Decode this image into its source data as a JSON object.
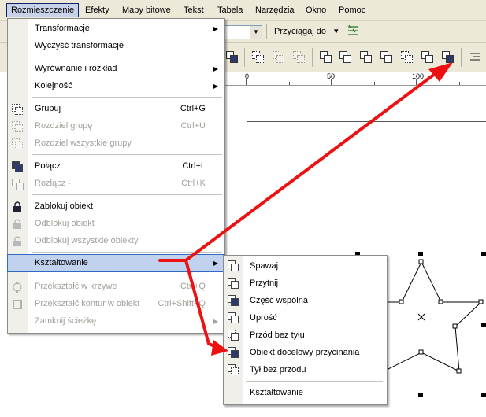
{
  "menubar": {
    "items": [
      {
        "label": "Rozmieszczenie",
        "name": "menu-rozmieszczenie",
        "active": true
      },
      {
        "label": "Efekty",
        "name": "menu-efekty"
      },
      {
        "label": "Mapy bitowe",
        "name": "menu-mapy-bitowe"
      },
      {
        "label": "Tekst",
        "name": "menu-tekst"
      },
      {
        "label": "Tabela",
        "name": "menu-tabela"
      },
      {
        "label": "Narzędzia",
        "name": "menu-narzedzia"
      },
      {
        "label": "Okno",
        "name": "menu-okno"
      },
      {
        "label": "Pomoc",
        "name": "menu-pomoc"
      }
    ]
  },
  "toolbar": {
    "snap_label": "Przyciągaj do",
    "snap_arrow": "▾"
  },
  "ruler": {
    "ticks": [
      "0",
      "50",
      "100"
    ]
  },
  "dropdown": {
    "items": [
      {
        "label": "Transformacje",
        "submenu": true
      },
      {
        "label": "Wyczyść transformacje"
      },
      {
        "label": "Wyrównanie i rozkład",
        "submenu": true
      },
      {
        "label": "Kolejność",
        "submenu": true
      },
      {
        "label": "Grupuj",
        "shortcut": "Ctrl+G",
        "icon": "group-icon"
      },
      {
        "label": "Rozdziel grupę",
        "shortcut": "Ctrl+U",
        "disabled": true,
        "icon": "ungroup-icon"
      },
      {
        "label": "Rozdziel wszystkie grupy",
        "disabled": true,
        "icon": "ungroup-all-icon"
      },
      {
        "label": "Połącz",
        "shortcut": "Ctrl+L",
        "icon": "combine-icon"
      },
      {
        "label": "Rozłącz -",
        "shortcut": "Ctrl+K",
        "disabled": true,
        "icon": "break-apart-icon"
      },
      {
        "label": "Zablokuj obiekt",
        "icon": "lock-icon"
      },
      {
        "label": "Odblokuj obiekt",
        "disabled": true,
        "icon": "unlock-icon"
      },
      {
        "label": "Odblokuj wszystkie obiekty",
        "disabled": true,
        "icon": "unlock-all-icon"
      },
      {
        "label": "Kształtowanie",
        "submenu": true,
        "highlighted": true
      },
      {
        "label": "Przekształć w krzywe",
        "shortcut": "Ctrl+Q",
        "disabled": true,
        "icon": "convert-curves-icon"
      },
      {
        "label": "Przekształć kontur w obiekt",
        "shortcut": "Ctrl+Shift+Q",
        "disabled": true,
        "icon": "outline-to-object-icon"
      },
      {
        "label": "Zamknij ścieżkę",
        "submenu": true,
        "disabled": true
      }
    ]
  },
  "submenu": {
    "items": [
      {
        "label": "Spawaj",
        "icon": "weld-icon"
      },
      {
        "label": "Przytnij",
        "icon": "trim-icon"
      },
      {
        "label": "Część wspólna",
        "icon": "intersect-icon"
      },
      {
        "label": "Uprość",
        "icon": "simplify-icon"
      },
      {
        "label": "Przód bez tyłu",
        "icon": "front-minus-back-icon"
      },
      {
        "label": "Obiekt docelowy przycinania",
        "icon": "target-trim-icon"
      },
      {
        "label": "Tył bez przodu",
        "icon": "back-minus-front-icon"
      },
      {
        "label": "Kształtowanie"
      }
    ]
  },
  "colors": {
    "annotation_arrow": "#ee1111",
    "menu_highlight": "#c1d2ee",
    "disabled_text": "#a3a19a"
  }
}
